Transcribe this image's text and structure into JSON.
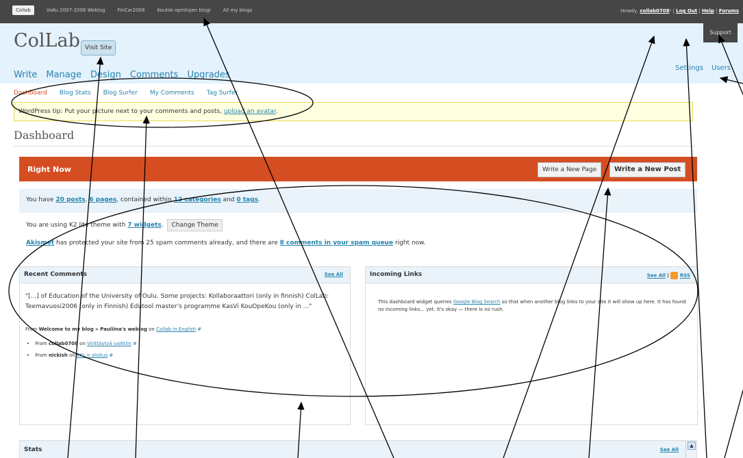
{
  "topbar": {
    "blog_tabs": [
      "Collab",
      "VaKu 2007-2008 Weblog",
      "FinCar2008",
      "Koutsk-opintojen blogi",
      "All my blogs"
    ],
    "howdy_text": "Howdy,",
    "username": "collab0708",
    "exclaim": "!",
    "sep": "|",
    "logout": "Log Out",
    "help": "Help",
    "forums": "Forums"
  },
  "header": {
    "site_title": "ColLab",
    "visit_site": "Visit Site",
    "main_menu": [
      "Write",
      "Manage",
      "Design",
      "Comments",
      "Upgrades"
    ],
    "side_menu": [
      "Settings",
      "Users"
    ],
    "support": "Support"
  },
  "submenu": [
    "Dashboard",
    "Blog Stats",
    "Blog Surfer",
    "My Comments",
    "Tag Surfer"
  ],
  "tip": {
    "text": "WordPress tip: Put your picture next to your comments and posts,",
    "link": "upload an avatar",
    "end": "."
  },
  "page_heading": "Dashboard",
  "right_now": {
    "title": "Right Now",
    "write_page": "Write a New Page",
    "write_post": "Write a New Post",
    "row1": {
      "t1": "You have ",
      "posts": "20 posts",
      "t2": ", ",
      "pages": "6 pages",
      "t3": ", contained within ",
      "categories": "12 categories",
      "t4": " and ",
      "tags": "0 tags",
      "t5": "."
    },
    "row2": {
      "t1": "You are using K2 lite theme with ",
      "widgets": "7 widgets",
      "t2": ".",
      "change_theme": "Change Theme"
    },
    "row3": {
      "akismet": "Akismet",
      "t1": " has protected your site from 25 spam comments already, and there are ",
      "queue": "8 comments in your spam queue",
      "t2": " right now."
    }
  },
  "recent_comments": {
    "title": "Recent Comments",
    "see_all": "See All",
    "excerpt": "\"[...] of Education of the University of Oulu. Some projects: Kollaboraattori (only in finnish) ColLab: Teemavuosi2006 (only in Finnish) Edutool master's programme KasVi KouOpeKou (only in ...\"",
    "from_label": "From",
    "from_source": "Welcome to my blog « Pauliina's weblog",
    "on": "on",
    "on_link": "Collab in English",
    "hash": "#",
    "items": [
      {
        "from": "From",
        "author": "collab0708",
        "on": "on",
        "post": "Virittäytyä vaihtiin",
        "hash": "#"
      },
      {
        "from": "From",
        "author": "nickish",
        "on": "on",
        "post": "EKL:n aloitus",
        "hash": "#"
      }
    ]
  },
  "incoming_links": {
    "title": "Incoming Links",
    "see_all": "See All",
    "sep": "|",
    "rss": "RSS",
    "t1": "This dashboard widget queries ",
    "link": "Google Blog Search",
    "t2": " so that when another blog links to your site it will show up here. It has found no incoming links... yet. It's okay — there is no rush."
  },
  "stats": {
    "title": "Stats",
    "see_all": "See All",
    "scroll_up": "▲"
  },
  "colors": {
    "admin_bar": "#464646",
    "header_bg": "#e4f2fd",
    "accent_orange": "#d54e21",
    "link_blue": "#2583ad",
    "tip_bg": "#ffffe0"
  },
  "icons": [
    "rss-icon",
    "scroll-up-arrow-icon"
  ]
}
